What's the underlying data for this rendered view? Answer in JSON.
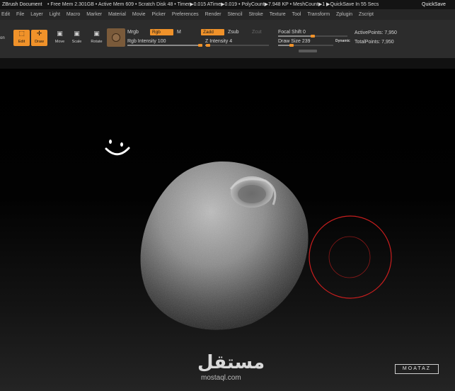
{
  "titlebar": {
    "app": "ZBrush Document",
    "stats": "• Free Mem 2.301GB • Active Mem 609 • Scratch Disk 48 • Timer▶0.015 ATime▶0.019 • PolyCount▶7.948 KP • MeshCount▶1 ▶QuickSave In 55 Secs",
    "quicksave": "QuickSave"
  },
  "menu": [
    "Edit",
    "File",
    "Layer",
    "Light",
    "Macro",
    "Marker",
    "Material",
    "Movie",
    "Picker",
    "Preferences",
    "Render",
    "Stencil",
    "Stroke",
    "Texture",
    "Tool",
    "Transform",
    "Zplugin",
    "Zscript"
  ],
  "toolbar": {
    "side_label": "on",
    "edit": "Edit",
    "draw": "Draw",
    "move": "Move",
    "scale": "Scale",
    "rotate": "Rotate",
    "mrgb": "Mrgb",
    "rgb": "Rgb",
    "m": "M",
    "zadd": "Zadd",
    "zsub": "Zsub",
    "zcut": "Zcut",
    "rgb_intensity": "Rgb Intensity 100",
    "z_intensity": "Z Intensity 4",
    "focal_shift": "Focal Shift 0",
    "draw_size": "Draw Size 239",
    "dynamic": "Dynamic",
    "active_points": "ActivePoints: 7,950",
    "total_points": "TotalPoints: 7,950"
  },
  "sliders": {
    "rgb_intensity": 1.0,
    "z_intensity": 0.04,
    "focal_shift": 0.5,
    "draw_size": 0.24
  },
  "canvas": {
    "smiley": "☺",
    "watermark": "مستقل",
    "watermark_url": "mostaql.com",
    "signature": "MOATAZ"
  },
  "colors": {
    "accent": "#f0922a",
    "brush_ring": "#c81e1e"
  }
}
